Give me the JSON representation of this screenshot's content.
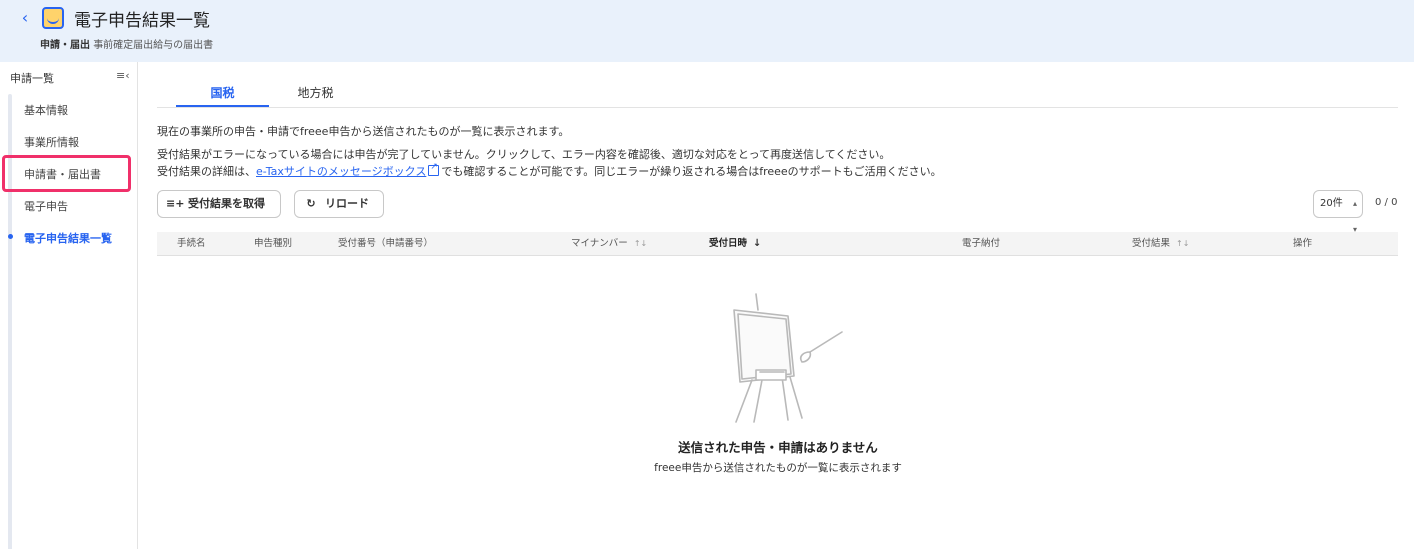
{
  "header": {
    "title": "電子申告結果一覧",
    "breadcrumb_strong": "申請・届出",
    "breadcrumb_rest": "事前確定届出給与の届出書"
  },
  "sidebar": {
    "heading": "申請一覧",
    "items": [
      {
        "label": "基本情報"
      },
      {
        "label": "事業所情報"
      },
      {
        "label": "申請書・届出書"
      },
      {
        "label": "電子申告"
      },
      {
        "label": "電子申告結果一覧",
        "active": true
      }
    ]
  },
  "tabs": [
    {
      "label": "国税",
      "active": true
    },
    {
      "label": "地方税",
      "active": false
    }
  ],
  "description": {
    "line1": "現在の事業所の申告・申請でfreee申告から送信されたものが一覧に表示されます。",
    "line2": "受付結果がエラーになっている場合には申告が完了していません。クリックして、エラー内容を確認後、適切な対応をとって再度送信してください。",
    "line3_prefix": "受付結果の詳細は、",
    "line3_link": "e-Taxサイトのメッセージボックス",
    "line3_suffix": "でも確認することが可能です。同じエラーが繰り返される場合はfreeeのサポートもご活用ください。"
  },
  "toolbar": {
    "fetch_label": "受付結果を取得",
    "reload_label": "リロード",
    "per_page": "20件",
    "pager": "0 / 0"
  },
  "table": {
    "columns": [
      "手続名",
      "申告種別",
      "受付番号（申請番号）",
      "マイナンバー",
      "受付日時",
      "電子納付",
      "受付結果",
      "操作"
    ]
  },
  "empty": {
    "title": "送信された申告・申請はありません",
    "subtitle": "freee申告から送信されたものが一覧に表示されます"
  },
  "colors": {
    "accent": "#2864f0",
    "header_bg": "#e9f1fb",
    "highlight": "#f0306a"
  }
}
